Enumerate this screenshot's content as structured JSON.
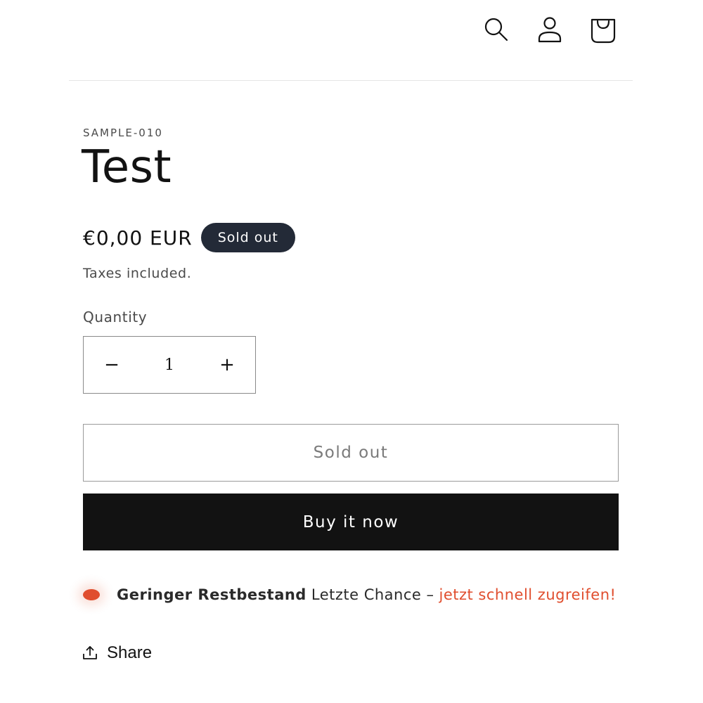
{
  "header": {
    "icons": [
      "search-icon",
      "account-icon",
      "cart-icon"
    ]
  },
  "product": {
    "sku": "SAMPLE-010",
    "title": "Test",
    "price": "€0,00 EUR",
    "badge": "Sold out",
    "taxes": "Taxes included."
  },
  "quantity": {
    "label": "Quantity",
    "value": "1",
    "minus": "−",
    "plus": "+"
  },
  "buttons": {
    "sold_out": "Sold out",
    "buy_now": "Buy it now"
  },
  "stock": {
    "strong": "Geringer Restbestand",
    "text": "Letzte Chance –",
    "cta": "jetzt schnell zugreifen!"
  },
  "share": {
    "label": "Share"
  },
  "colors": {
    "accent": "#e04e2e",
    "badge_bg": "#232a37",
    "button_dark": "#121212"
  }
}
